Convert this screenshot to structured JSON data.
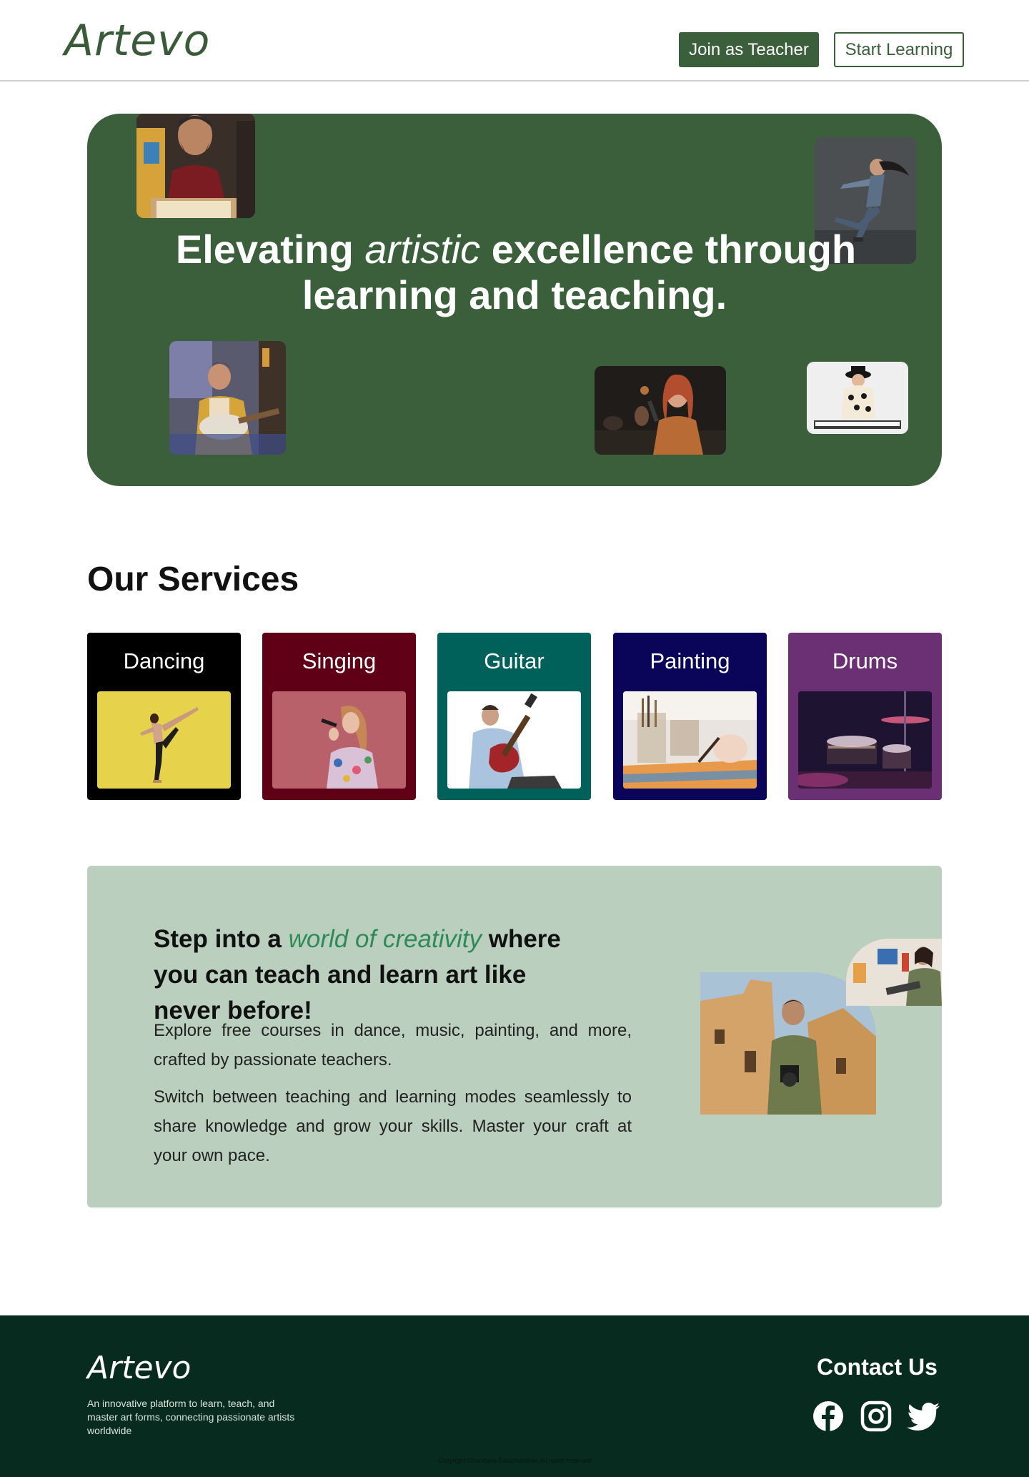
{
  "header": {
    "logo": "Artevo",
    "join_teacher_label": "Join as Teacher",
    "start_learning_label": "Start Learning"
  },
  "hero": {
    "title_part1": "Elevating ",
    "title_em": "artistic",
    "title_part2": " excellence through",
    "title_line2": "learning and teaching."
  },
  "services": {
    "title": "Our Services",
    "items": [
      {
        "label": "Dancing",
        "color": "#000000"
      },
      {
        "label": "Singing",
        "color": "#600017"
      },
      {
        "label": "Guitar",
        "color": "#00605a"
      },
      {
        "label": "Painting",
        "color": "#0b0559"
      },
      {
        "label": "Drums",
        "color": "#6b2f73"
      }
    ]
  },
  "creative": {
    "heading_part1": "Step into a ",
    "heading_em": "world of creativity",
    "heading_part2": " where you can teach and learn art like never before!",
    "paragraph1": "Explore free courses in dance, music, painting, and more, crafted by passionate teachers.",
    "paragraph2": "Switch between teaching and learning modes seamlessly to share knowledge and grow your skills. Master your craft at your own pace."
  },
  "footer": {
    "logo": "Artevo",
    "tagline": "An innovative platform to learn, teach, and master art forms, connecting passionate artists worldwide",
    "contact_title": "Contact Us",
    "social_icons": [
      "facebook-icon",
      "instagram-icon",
      "twitter-icon"
    ],
    "copyright": "Copyright Chandana Balachandran All rights reserved"
  },
  "colors": {
    "brand_green": "#3b5e3b",
    "creative_bg": "#bacfbd",
    "footer_bg": "#082b20",
    "accent_italic": "#2e8b57"
  }
}
